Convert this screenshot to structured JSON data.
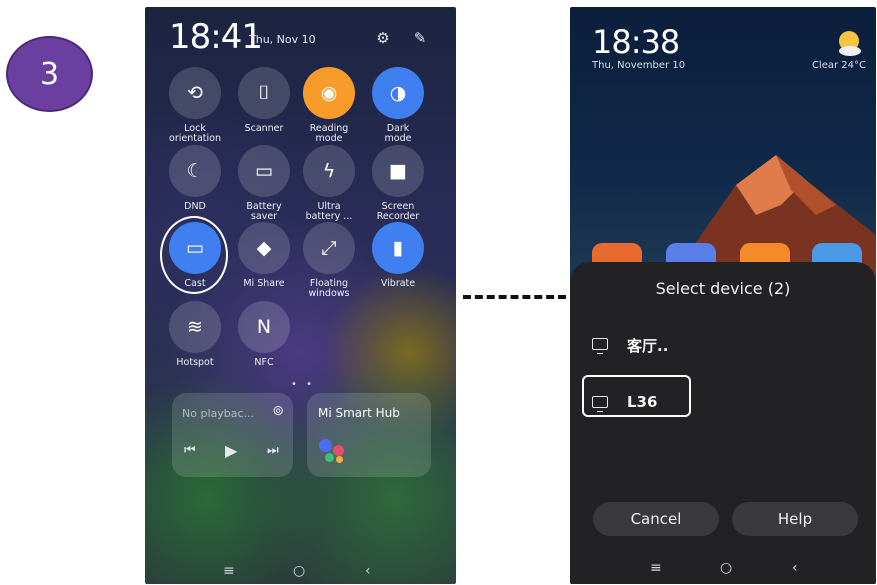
{
  "step": {
    "number": "3"
  },
  "left_phone": {
    "time": "18:41",
    "date": "Thu, Nov 10",
    "header_icons": [
      "settings-icon",
      "edit-icon"
    ],
    "tiles": [
      {
        "id": "lock-orientation",
        "label_line1": "Lock",
        "label_line2": "orientation",
        "glyph": "⟲",
        "state": "off"
      },
      {
        "id": "scanner",
        "label_line1": "Scanner",
        "label_line2": "",
        "glyph": "⌷",
        "state": "off"
      },
      {
        "id": "reading-mode",
        "label_line1": "Reading",
        "label_line2": "mode",
        "glyph": "◉",
        "state": "orange"
      },
      {
        "id": "dark-mode",
        "label_line1": "Dark",
        "label_line2": "mode",
        "glyph": "◑",
        "state": "blue"
      },
      {
        "id": "dnd",
        "label_line1": "DND",
        "label_line2": "",
        "glyph": "☾",
        "state": "off"
      },
      {
        "id": "battery-saver",
        "label_line1": "Battery",
        "label_line2": "saver",
        "glyph": "▭",
        "state": "off"
      },
      {
        "id": "ultra-battery",
        "label_line1": "Ultra",
        "label_line2": "battery ...",
        "glyph": "ϟ",
        "state": "off"
      },
      {
        "id": "screen-recorder",
        "label_line1": "Screen",
        "label_line2": "Recorder",
        "glyph": "■",
        "state": "off"
      },
      {
        "id": "cast",
        "label_line1": "Cast",
        "label_line2": "",
        "glyph": "▭",
        "state": "blue"
      },
      {
        "id": "mi-share",
        "label_line1": "Mi Share",
        "label_line2": "",
        "glyph": "◆",
        "state": "off"
      },
      {
        "id": "floating-windows",
        "label_line1": "Floating",
        "label_line2": "windows",
        "glyph": "⤢",
        "state": "off"
      },
      {
        "id": "vibrate",
        "label_line1": "Vibrate",
        "label_line2": "",
        "glyph": "▮",
        "state": "blue"
      },
      {
        "id": "hotspot",
        "label_line1": "Hotspot",
        "label_line2": "",
        "glyph": "≋",
        "state": "off"
      },
      {
        "id": "nfc",
        "label_line1": "NFC",
        "label_line2": "",
        "glyph": "N",
        "state": "off"
      }
    ],
    "media_card": {
      "title": "No playbac...",
      "prev": "⏮",
      "play": "▶",
      "next": "⏭"
    },
    "hub_card": {
      "title": "Mi Smart Hub"
    },
    "nav": {
      "menu": "≡",
      "home": "○",
      "back": "‹"
    }
  },
  "right_phone": {
    "time": "18:38",
    "date": "Thu, November 10",
    "weather": "Clear 24°C",
    "sheet": {
      "title": "Select device (2)",
      "devices": [
        "客厅..",
        "L36"
      ],
      "cancel_label": "Cancel",
      "help_label": "Help"
    },
    "nav": {
      "menu": "≡",
      "home": "○",
      "back": "‹"
    }
  },
  "colors": {
    "accent_blue": "#3f7ff0",
    "accent_orange": "#f79b2b",
    "badge_purple": "#6a3fa0"
  }
}
